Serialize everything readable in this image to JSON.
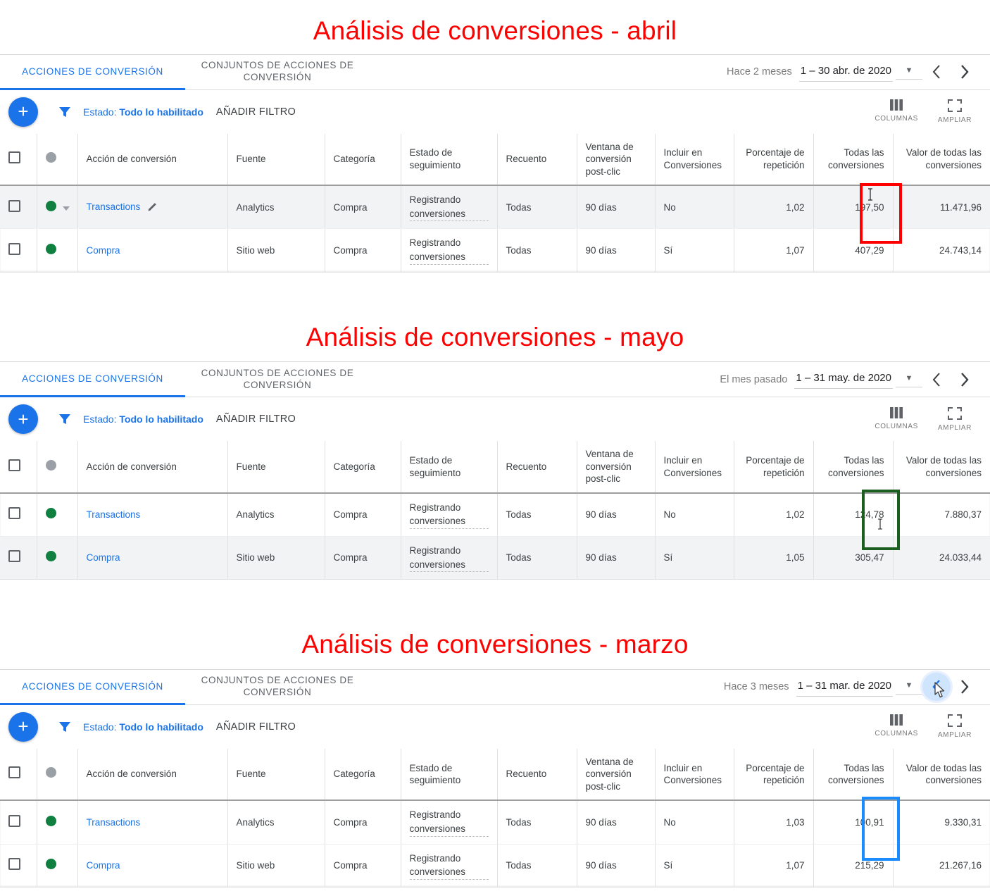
{
  "colors": {
    "accent_blue": "#1a73e8",
    "title_red": "#ff0000",
    "highlight_red": "#ff0000",
    "highlight_green": "#1b5e20",
    "highlight_blue": "#1a8cff",
    "status_green": "#0f8040",
    "grey_dot": "#9aa0a6"
  },
  "common": {
    "tabs": [
      {
        "label": "ACCIONES DE CONVERSIÓN",
        "active": true
      },
      {
        "label": "CONJUNTOS DE ACCIONES DE CONVERSIÓN",
        "active": false
      }
    ],
    "filter_bar": {
      "add_button": "+",
      "funnel_icon": "filter-funnel-icon",
      "status_prefix": "Estado:",
      "status_value": "Todo lo habilitado",
      "add_filter": "AÑADIR FILTRO",
      "columns_label": "COLUMNAS",
      "expand_label": "AMPLIAR"
    },
    "columns": [
      "",
      "",
      "Acción de conversión",
      "Fuente",
      "Categoría",
      "Estado de seguimiento",
      "Recuento",
      "Ventana de conversión post-clic",
      "Incluir en Conversiones",
      "Porcentaje de repetición",
      "Todas las conversiones",
      "Valor de todas las conversiones"
    ]
  },
  "panels": [
    {
      "title": "Análisis de conversiones - abril",
      "date_label": "Hace 2 meses",
      "date_value": "1 – 30 abr. de 2020",
      "prev_clicked": false,
      "highlight_color": "red",
      "rows": [
        {
          "action": "Transactions",
          "source": "Analytics",
          "category": "Compra",
          "tracking": "Registrando conversiones",
          "count": "Todas",
          "window": "90 días",
          "include": "No",
          "repeat_rate": "1,02",
          "all_conversions": "197,50",
          "all_conversions_value": "11.471,96",
          "hovered": true,
          "has_pencil": true,
          "has_caret": true
        },
        {
          "action": "Compra",
          "source": "Sitio web",
          "category": "Compra",
          "tracking": "Registrando conversiones",
          "count": "Todas",
          "window": "90 días",
          "include": "Sí",
          "repeat_rate": "1,07",
          "all_conversions": "407,29",
          "all_conversions_value": "24.743,14",
          "hovered": false,
          "has_pencil": false,
          "has_caret": false
        }
      ]
    },
    {
      "title": "Análisis de conversiones - mayo",
      "date_label": "El mes pasado",
      "date_value": "1 – 31 may. de 2020",
      "prev_clicked": false,
      "highlight_color": "green",
      "rows": [
        {
          "action": "Transactions",
          "source": "Analytics",
          "category": "Compra",
          "tracking": "Registrando conversiones",
          "count": "Todas",
          "window": "90 días",
          "include": "No",
          "repeat_rate": "1,02",
          "all_conversions": "124,78",
          "all_conversions_value": "7.880,37",
          "hovered": false,
          "has_pencil": false,
          "has_caret": false
        },
        {
          "action": "Compra",
          "source": "Sitio web",
          "category": "Compra",
          "tracking": "Registrando conversiones",
          "count": "Todas",
          "window": "90 días",
          "include": "Sí",
          "repeat_rate": "1,05",
          "all_conversions": "305,47",
          "all_conversions_value": "24.033,44",
          "hovered": true,
          "has_pencil": false,
          "has_caret": false
        }
      ]
    },
    {
      "title": "Análisis de conversiones - marzo",
      "date_label": "Hace 3 meses",
      "date_value": "1 – 31 mar. de 2020",
      "prev_clicked": true,
      "highlight_color": "blue",
      "rows": [
        {
          "action": "Transactions",
          "source": "Analytics",
          "category": "Compra",
          "tracking": "Registrando conversiones",
          "count": "Todas",
          "window": "90 días",
          "include": "No",
          "repeat_rate": "1,03",
          "all_conversions": "100,91",
          "all_conversions_value": "9.330,31",
          "hovered": false,
          "has_pencil": false,
          "has_caret": false
        },
        {
          "action": "Compra",
          "source": "Sitio web",
          "category": "Compra",
          "tracking": "Registrando conversiones",
          "count": "Todas",
          "window": "90 días",
          "include": "Sí",
          "repeat_rate": "1,07",
          "all_conversions": "215,29",
          "all_conversions_value": "21.267,16",
          "hovered": false,
          "has_pencil": false,
          "has_caret": false
        }
      ]
    }
  ]
}
